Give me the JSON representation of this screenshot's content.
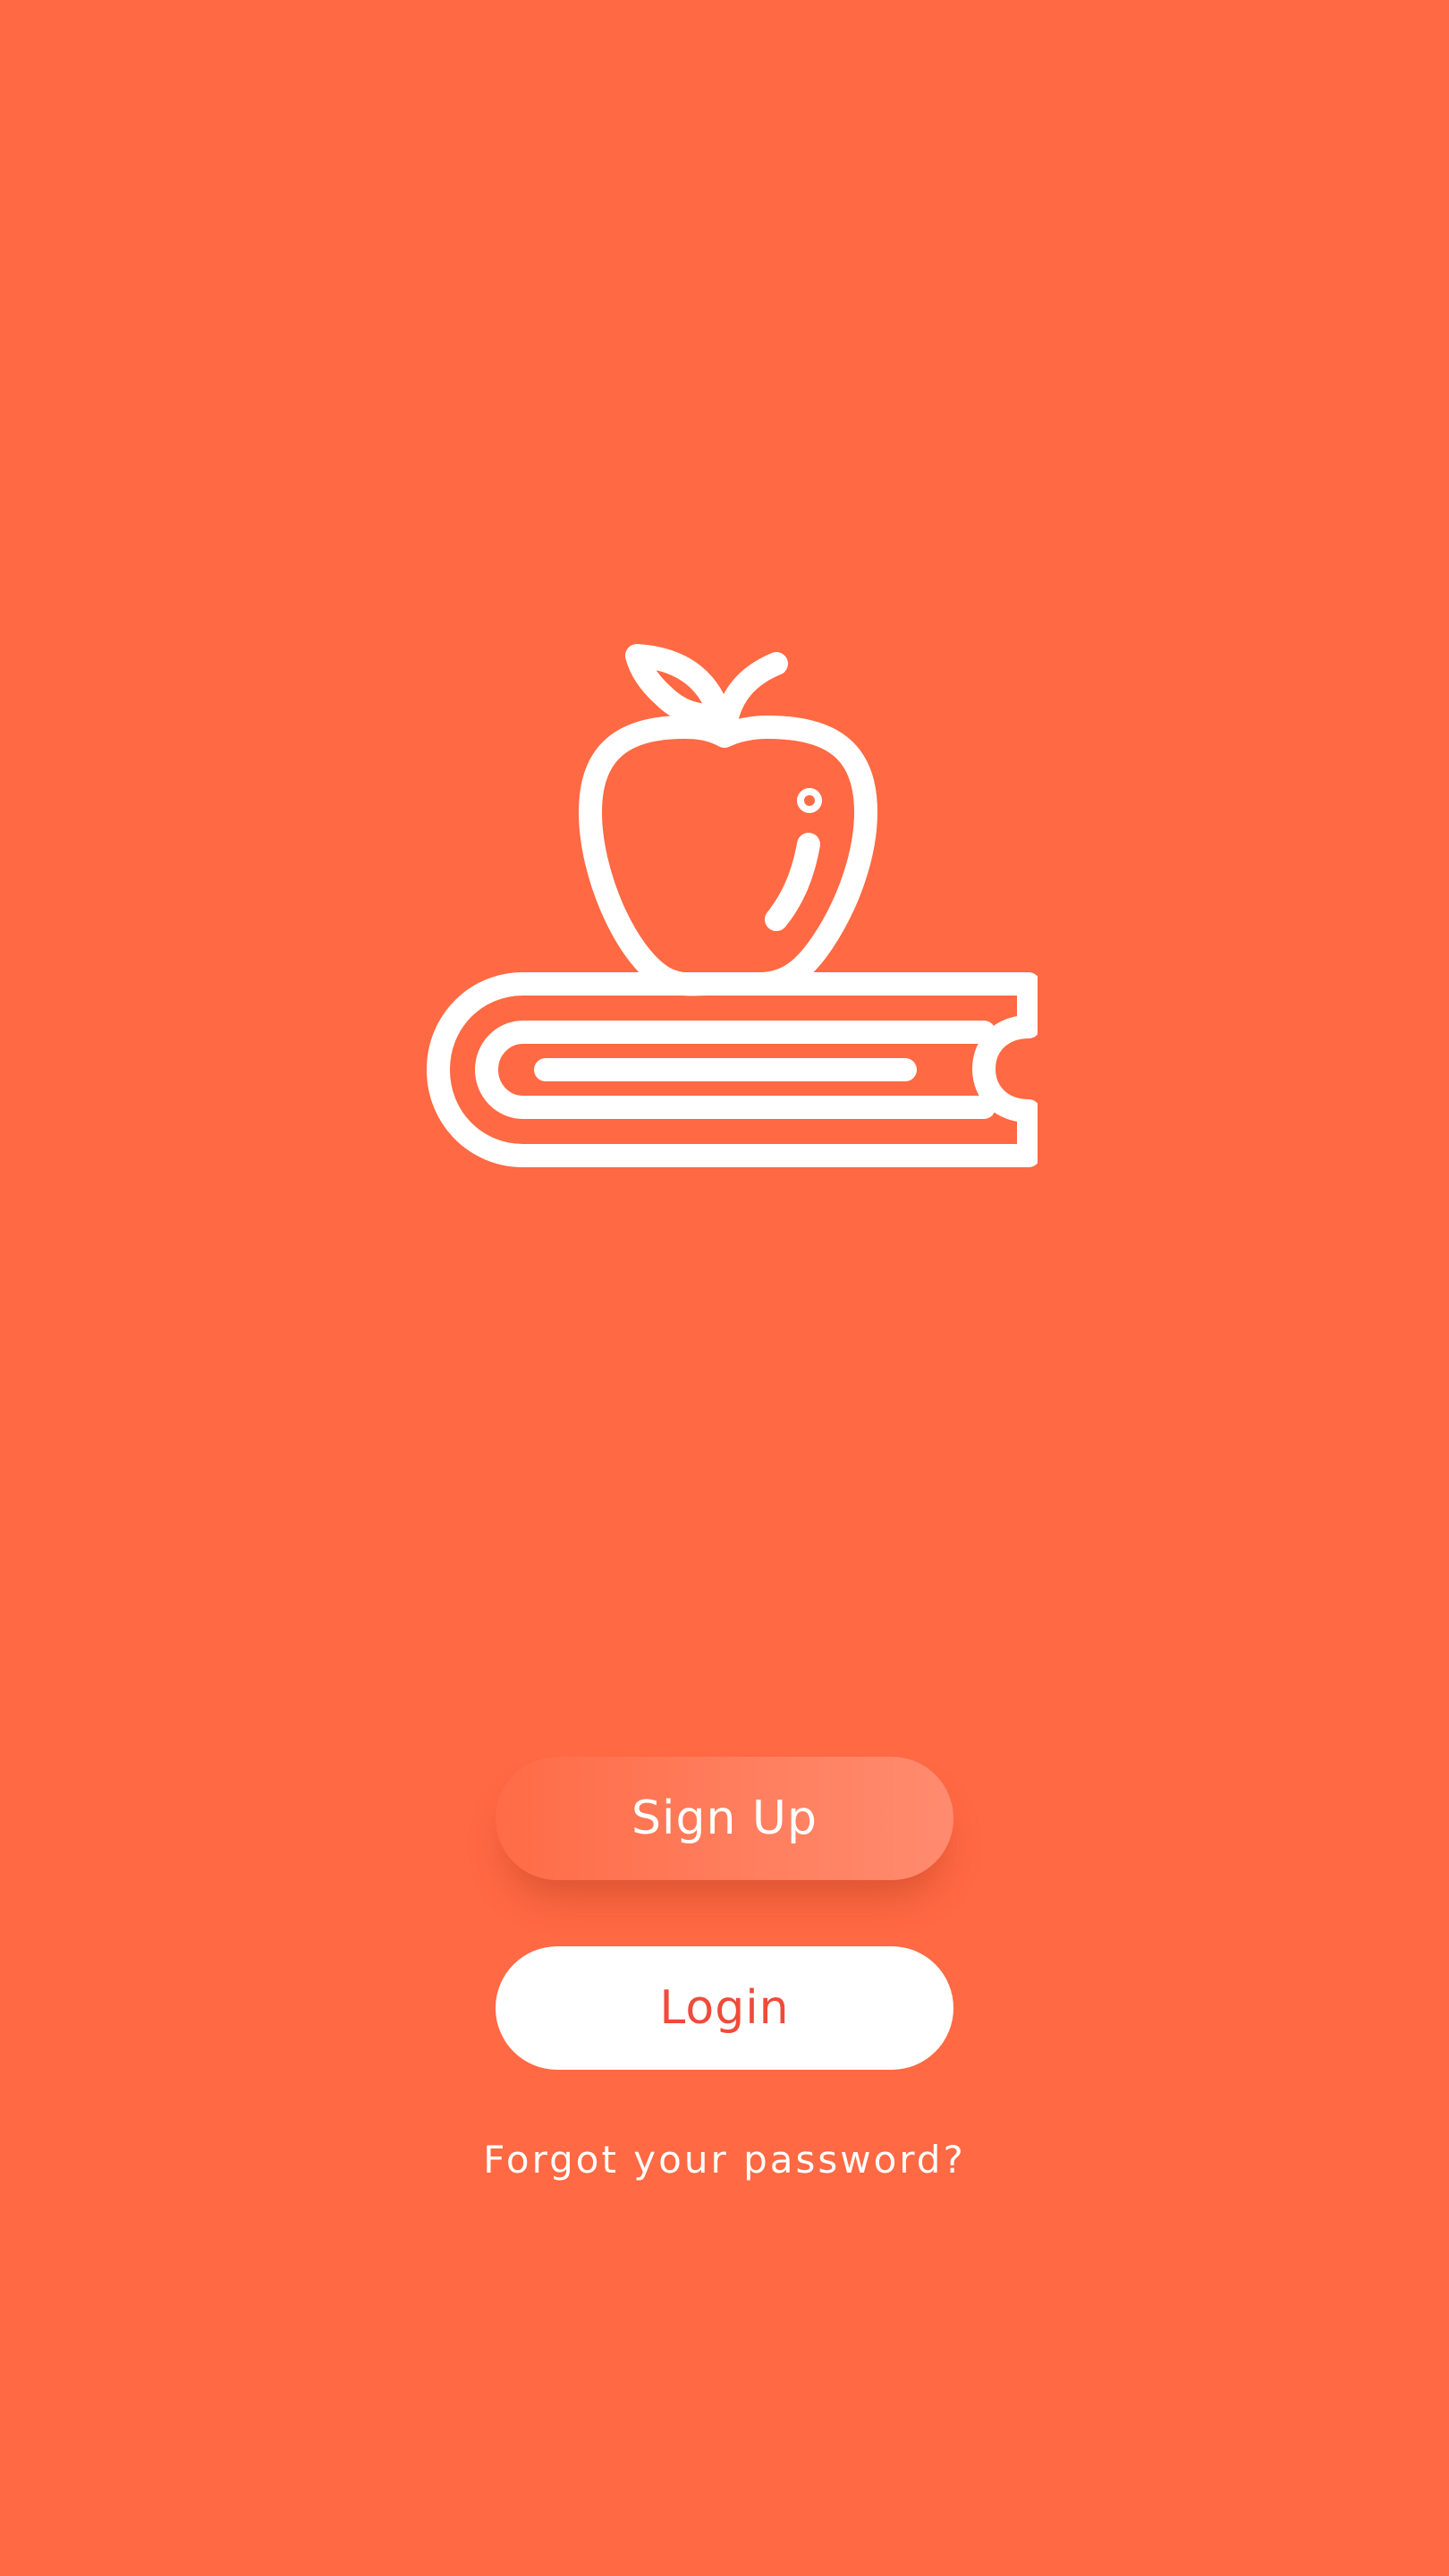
{
  "colors": {
    "background": "#FF6943",
    "signup_gradient_start": "#FF6B46",
    "signup_gradient_end": "#FF8B6E",
    "login_background": "#FFFFFF",
    "login_text": "#EF4B3A",
    "text_light": "#FFFFFF"
  },
  "logo": {
    "icon": "apple-on-books-icon"
  },
  "actions": {
    "signup_label": "Sign Up",
    "login_label": "Login",
    "forgot_password_label": "Forgot your password?"
  }
}
